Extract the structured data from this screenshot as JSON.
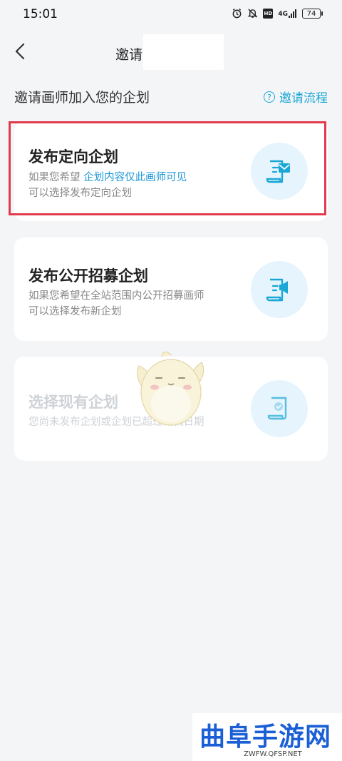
{
  "status_bar": {
    "time": "15:01",
    "battery": "74",
    "network": "4G",
    "hd": "HD"
  },
  "nav": {
    "title": "邀请"
  },
  "section": {
    "title": "邀请画师加入您的企划",
    "help_link": "邀请流程",
    "help_icon_glyph": "?"
  },
  "cards": [
    {
      "title": "发布定向企划",
      "desc_prefix": "如果您希望 ",
      "desc_highlight": "企划内容仅此画师可见",
      "desc_line2": "可以选择发布定向企划",
      "icon": "envelope-document-icon",
      "disabled": false
    },
    {
      "title": "发布公开招募企划",
      "desc_line1": "如果您希望在全站范围内公开招募画师",
      "desc_line2": "可以选择发布新企划",
      "icon": "megaphone-document-icon",
      "disabled": false
    },
    {
      "title": "选择现有企划",
      "desc_line1": "您尚未发布企划或企划已超过截稿日期",
      "icon": "check-document-icon",
      "disabled": true
    }
  ],
  "watermark": {
    "main": "曲阜手游网",
    "sub": "ZWFW.QFSP.NET"
  },
  "colors": {
    "accent": "#1aa7d6",
    "highlight_border": "#e23a4d",
    "background": "#f4f5f7",
    "icon_bg": "#e6f4fd"
  }
}
